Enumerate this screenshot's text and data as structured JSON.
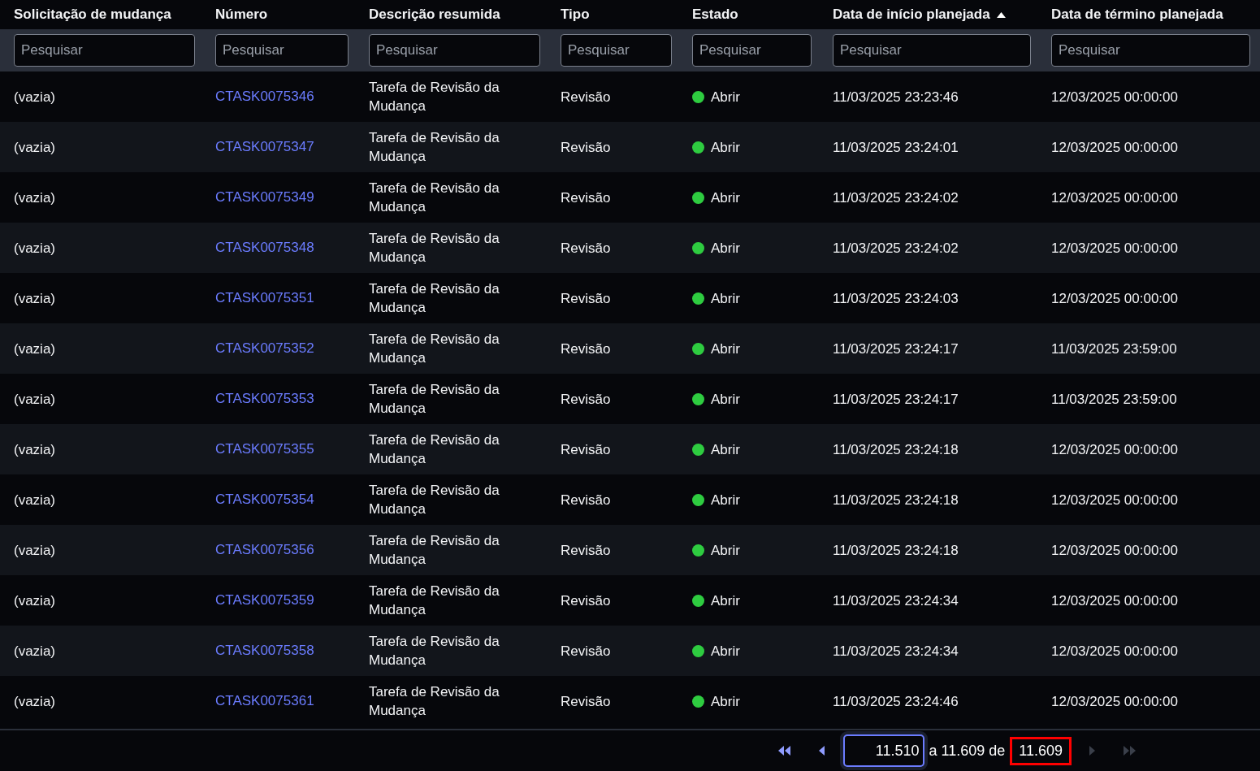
{
  "columns": [
    {
      "label": "Solicitação de mudança",
      "sorted_ascending": false,
      "placeholder": "Pesquisar"
    },
    {
      "label": "Número",
      "sorted_ascending": false,
      "placeholder": "Pesquisar"
    },
    {
      "label": "Descrição resumida",
      "sorted_ascending": false,
      "placeholder": "Pesquisar"
    },
    {
      "label": "Tipo",
      "sorted_ascending": false,
      "placeholder": "Pesquisar"
    },
    {
      "label": "Estado",
      "sorted_ascending": false,
      "placeholder": "Pesquisar"
    },
    {
      "label": "Data de início planejada",
      "sorted_ascending": true,
      "placeholder": "Pesquisar"
    },
    {
      "label": "Data de término planejada",
      "sorted_ascending": false,
      "placeholder": "Pesquisar"
    }
  ],
  "rows": [
    {
      "change_request": "(vazia)",
      "number": "CTASK0075346",
      "description": "Tarefa de Revisão da Mudança",
      "type": "Revisão",
      "state": "Abrir",
      "color": "#2ecc40",
      "start": "11/03/2025 23:23:46",
      "end": "12/03/2025 00:00:00"
    },
    {
      "change_request": "(vazia)",
      "number": "CTASK0075347",
      "description": "Tarefa de Revisão da Mudança",
      "type": "Revisão",
      "state": "Abrir",
      "color": "#2ecc40",
      "start": "11/03/2025 23:24:01",
      "end": "12/03/2025 00:00:00"
    },
    {
      "change_request": "(vazia)",
      "number": "CTASK0075349",
      "description": "Tarefa de Revisão da Mudança",
      "type": "Revisão",
      "state": "Abrir",
      "color": "#2ecc40",
      "start": "11/03/2025 23:24:02",
      "end": "12/03/2025 00:00:00"
    },
    {
      "change_request": "(vazia)",
      "number": "CTASK0075348",
      "description": "Tarefa de Revisão da Mudança",
      "type": "Revisão",
      "state": "Abrir",
      "color": "#2ecc40",
      "start": "11/03/2025 23:24:02",
      "end": "12/03/2025 00:00:00"
    },
    {
      "change_request": "(vazia)",
      "number": "CTASK0075351",
      "description": "Tarefa de Revisão da Mudança",
      "type": "Revisão",
      "state": "Abrir",
      "color": "#2ecc40",
      "start": "11/03/2025 23:24:03",
      "end": "12/03/2025 00:00:00"
    },
    {
      "change_request": "(vazia)",
      "number": "CTASK0075352",
      "description": "Tarefa de Revisão da Mudança",
      "type": "Revisão",
      "state": "Abrir",
      "color": "#2ecc40",
      "start": "11/03/2025 23:24:17",
      "end": "11/03/2025 23:59:00"
    },
    {
      "change_request": "(vazia)",
      "number": "CTASK0075353",
      "description": "Tarefa de Revisão da Mudança",
      "type": "Revisão",
      "state": "Abrir",
      "color": "#2ecc40",
      "start": "11/03/2025 23:24:17",
      "end": "11/03/2025 23:59:00"
    },
    {
      "change_request": "(vazia)",
      "number": "CTASK0075355",
      "description": "Tarefa de Revisão da Mudança",
      "type": "Revisão",
      "state": "Abrir",
      "color": "#2ecc40",
      "start": "11/03/2025 23:24:18",
      "end": "12/03/2025 00:00:00"
    },
    {
      "change_request": "(vazia)",
      "number": "CTASK0075354",
      "description": "Tarefa de Revisão da Mudança",
      "type": "Revisão",
      "state": "Abrir",
      "color": "#2ecc40",
      "start": "11/03/2025 23:24:18",
      "end": "12/03/2025 00:00:00"
    },
    {
      "change_request": "(vazia)",
      "number": "CTASK0075356",
      "description": "Tarefa de Revisão da Mudança",
      "type": "Revisão",
      "state": "Abrir",
      "color": "#2ecc40",
      "start": "11/03/2025 23:24:18",
      "end": "12/03/2025 00:00:00"
    },
    {
      "change_request": "(vazia)",
      "number": "CTASK0075359",
      "description": "Tarefa de Revisão da Mudança",
      "type": "Revisão",
      "state": "Abrir",
      "color": "#2ecc40",
      "start": "11/03/2025 23:24:34",
      "end": "12/03/2025 00:00:00"
    },
    {
      "change_request": "(vazia)",
      "number": "CTASK0075358",
      "description": "Tarefa de Revisão da Mudança",
      "type": "Revisão",
      "state": "Abrir",
      "color": "#2ecc40",
      "start": "11/03/2025 23:24:34",
      "end": "12/03/2025 00:00:00"
    },
    {
      "change_request": "(vazia)",
      "number": "CTASK0075361",
      "description": "Tarefa de Revisão da Mudança",
      "type": "Revisão",
      "state": "Abrir",
      "color": "#2ecc40",
      "start": "11/03/2025 23:24:46",
      "end": "12/03/2025 00:00:00"
    }
  ],
  "pagination": {
    "first": {
      "disabled": false
    },
    "previous": {
      "disabled": false
    },
    "page_start": "11.510",
    "range_text": "a 11.609 de",
    "total": "11.609",
    "total_highlighted": true,
    "next": {
      "disabled": true
    },
    "last": {
      "disabled": true
    }
  }
}
